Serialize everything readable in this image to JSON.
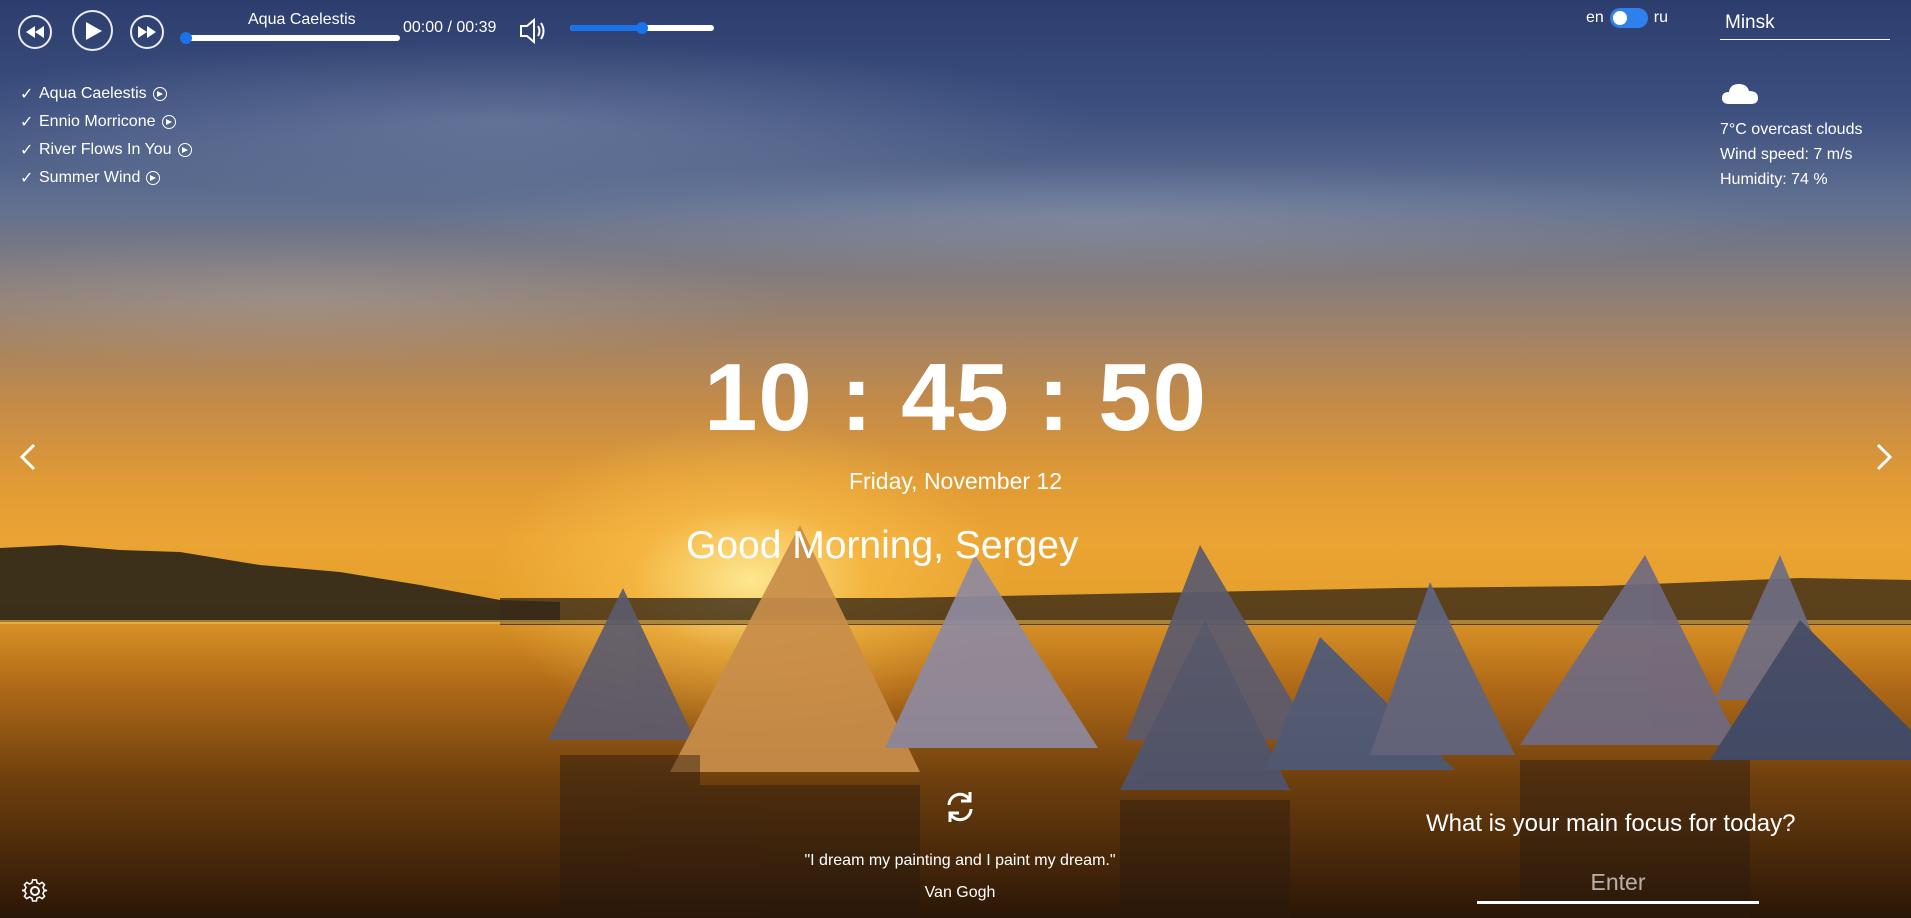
{
  "player": {
    "track_title": "Aqua Caelestis",
    "time": "00:00 / 00:39",
    "progress": 0,
    "volume": 0.5,
    "accent_color": "#1a73e8"
  },
  "playlist": [
    {
      "label": "Aqua Caelestis",
      "checked": true
    },
    {
      "label": "Ennio Morricone",
      "checked": true
    },
    {
      "label": "River Flows In You",
      "checked": true
    },
    {
      "label": "Summer Wind",
      "checked": true
    }
  ],
  "playlist_check": "✓",
  "language": {
    "left": "en",
    "right": "ru",
    "selected": "en"
  },
  "weather": {
    "city": "Minsk",
    "icon": "cloud-icon",
    "temp_desc": "7°C   overcast clouds",
    "wind": "Wind speed: 7 m/s",
    "humidity": "Humidity: 74 %"
  },
  "clock": "10 : 45 : 50",
  "date": "Friday, November 12",
  "greeting": "Good Morning,  Sergey",
  "quote": {
    "text": "\"I dream my painting and I paint my dream.\"",
    "author": "Van Gogh"
  },
  "focus": {
    "question": "What is your main focus for today?",
    "placeholder": "Enter"
  }
}
